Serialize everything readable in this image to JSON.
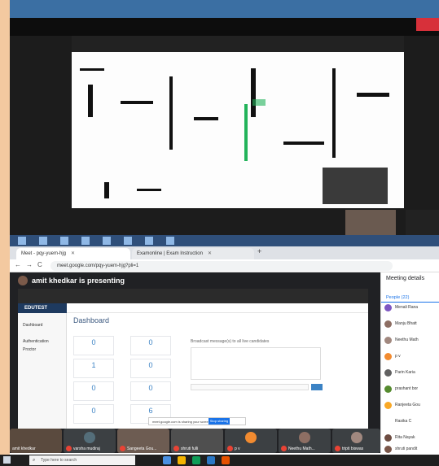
{
  "browser": {
    "tabs": [
      {
        "label": "Meet - pqy-yuem-hjg"
      },
      {
        "label": "Examonline | Exam Instruction"
      }
    ],
    "new_tab": "+",
    "url": "meet.google.com/pqy-yuem-hjg?pli=1",
    "nav": {
      "back": "←",
      "forward": "→",
      "reload": "C"
    }
  },
  "meet": {
    "presenting_text": "amit khedkar is presenting",
    "shared_app": {
      "brand": "EDUTEST",
      "menu": [
        "Dashboard",
        "Authentication",
        "Proctor"
      ],
      "dashboard_title": "Dashboard",
      "cards": [
        "0",
        "0",
        "1",
        "0",
        "0",
        "0",
        "0",
        "6"
      ],
      "broadcast_title": "Broadcast message(s) to all live candidates",
      "broadcast_button": "Send",
      "sharing_text": "meet.google.com is sharing your screen.",
      "stop_sharing": "Stop sharing",
      "hide": "Hide"
    },
    "tiles": [
      {
        "name": "amit khedkar"
      },
      {
        "name": "varsha mudiraj"
      },
      {
        "name": "Sangeeta Gou..."
      },
      {
        "name": "shruti fulli"
      },
      {
        "name": "p v"
      },
      {
        "name": "Neethu Math..."
      },
      {
        "name": "tripti biswas"
      }
    ]
  },
  "sidebar": {
    "title": "Meeting details",
    "people_tab": "People (22)",
    "people": [
      "Menali Rana",
      "Manju Bhatt",
      "Neethu Math",
      "p v",
      "Parin Karia",
      "prashant bor",
      "Ranjeeta Gou",
      "Rasika C",
      "Rita Nayak",
      "shruti pandit"
    ]
  },
  "taskbar": {
    "search_placeholder": "Type here to search"
  },
  "colors": {
    "meet_bg": "#202124",
    "accent": "#1a73e8",
    "mic_off": "#ea4335"
  }
}
